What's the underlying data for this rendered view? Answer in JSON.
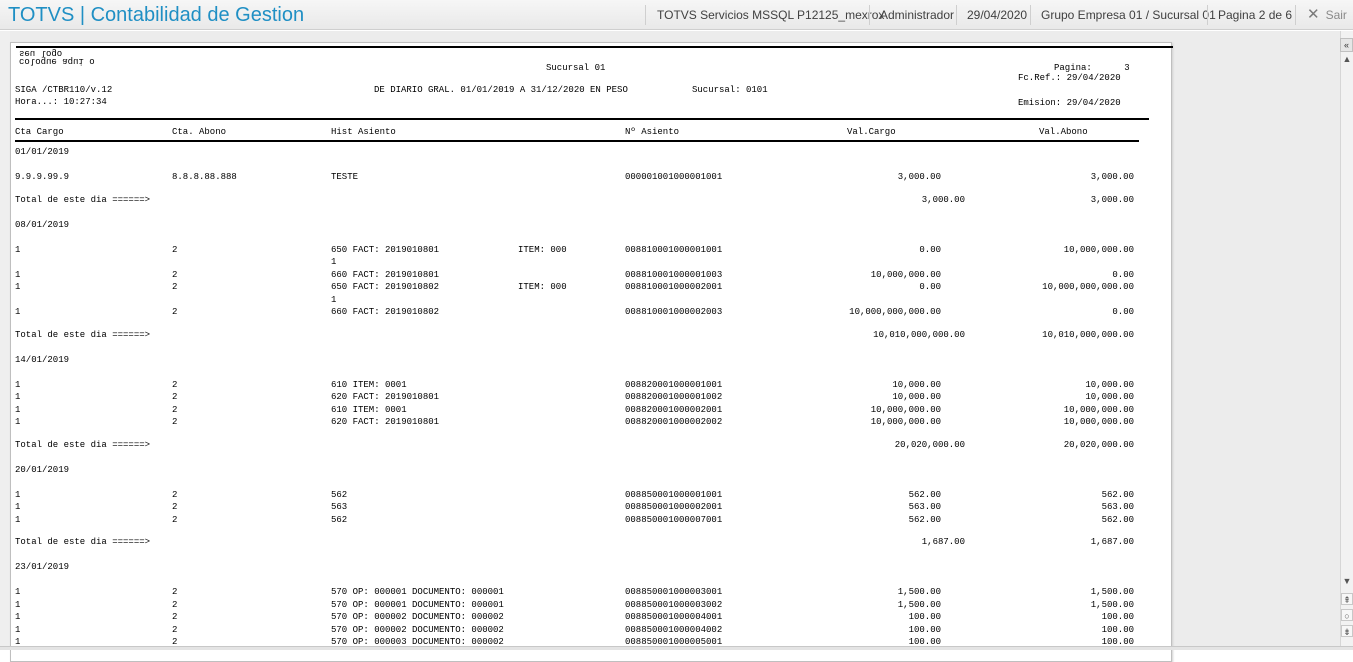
{
  "header": {
    "app_title": "TOTVS | Contabilidad de Gestion",
    "environment": "TOTVS Servicios MSSQL P12125_mexrox",
    "user": "Administrador",
    "date": "29/04/2020",
    "company": "Grupo Empresa 01 / Sucursal 01",
    "page": "Pagina 2 de 6",
    "exit_label": "Sair",
    "exit_icon": "close-icon"
  },
  "report": {
    "logo_text": "coloque aqui o seu logo",
    "title_branch": "Sucursal 01",
    "pagina": "Pagina:      3",
    "fc_ref": "Fc.Ref.: 29/04/2020",
    "program": "SIGA /CTBR110/v.12",
    "period": "DE DIARIO GRAL. 01/01/2019 A 31/12/2020 EN PESO",
    "sucursal": "Sucursal: 0101",
    "hora": "Hora...: 10:27:34",
    "emision": "Emision: 29/04/2020",
    "columns": {
      "cta_cargo": "Cta Cargo",
      "cta_abono": "Cta. Abono",
      "hist": "Hist Asiento",
      "asiento": "Nº Asiento",
      "val_cargo": "Val.Cargo",
      "val_abono": "Val.Abono"
    },
    "total_label": "Total de este dia ======>",
    "days": [
      {
        "date": "01/01/2019",
        "rows": [
          {
            "cargo": "9.9.9.99.9",
            "abono": "8.8.8.88.888",
            "hist": "TESTE",
            "item": "",
            "cont": "",
            "asiento": "000001001000001001",
            "vcargo": "3,000.00",
            "vabono": "3,000.00"
          }
        ],
        "total_cargo": "3,000.00",
        "total_abono": "3,000.00"
      },
      {
        "date": "08/01/2019",
        "rows": [
          {
            "cargo": "1",
            "abono": "2",
            "hist": "650 FACT: 2019010801",
            "item": "ITEM: 000",
            "cont": "1",
            "asiento": "008810001000001001",
            "vcargo": "0.00",
            "vabono": "10,000,000.00"
          },
          {
            "cargo": "1",
            "abono": "2",
            "hist": "660 FACT: 2019010801",
            "item": "",
            "cont": "",
            "asiento": "008810001000001003",
            "vcargo": "10,000,000.00",
            "vabono": "0.00"
          },
          {
            "cargo": "1",
            "abono": "2",
            "hist": "650 FACT: 2019010802",
            "item": "ITEM: 000",
            "cont": "1",
            "asiento": "008810001000002001",
            "vcargo": "0.00",
            "vabono": "10,000,000,000.00"
          },
          {
            "cargo": "1",
            "abono": "2",
            "hist": "660 FACT: 2019010802",
            "item": "",
            "cont": "",
            "asiento": "008810001000002003",
            "vcargo": "10,000,000,000.00",
            "vabono": "0.00"
          }
        ],
        "total_cargo": "10,010,000,000.00",
        "total_abono": "10,010,000,000.00"
      },
      {
        "date": "14/01/2019",
        "rows": [
          {
            "cargo": "1",
            "abono": "2",
            "hist": "610 ITEM: 0001",
            "item": "",
            "cont": "",
            "asiento": "008820001000001001",
            "vcargo": "10,000.00",
            "vabono": "10,000.00"
          },
          {
            "cargo": "1",
            "abono": "2",
            "hist": "620 FACT: 2019010801",
            "item": "",
            "cont": "",
            "asiento": "008820001000001002",
            "vcargo": "10,000.00",
            "vabono": "10,000.00"
          },
          {
            "cargo": "1",
            "abono": "2",
            "hist": "610 ITEM: 0001",
            "item": "",
            "cont": "",
            "asiento": "008820001000002001",
            "vcargo": "10,000,000.00",
            "vabono": "10,000,000.00"
          },
          {
            "cargo": "1",
            "abono": "2",
            "hist": "620 FACT: 2019010801",
            "item": "",
            "cont": "",
            "asiento": "008820001000002002",
            "vcargo": "10,000,000.00",
            "vabono": "10,000,000.00"
          }
        ],
        "total_cargo": "20,020,000.00",
        "total_abono": "20,020,000.00"
      },
      {
        "date": "20/01/2019",
        "rows": [
          {
            "cargo": "1",
            "abono": "2",
            "hist": "562",
            "item": "",
            "cont": "",
            "asiento": "008850001000001001",
            "vcargo": "562.00",
            "vabono": "562.00"
          },
          {
            "cargo": "1",
            "abono": "2",
            "hist": "563",
            "item": "",
            "cont": "",
            "asiento": "008850001000002001",
            "vcargo": "563.00",
            "vabono": "563.00"
          },
          {
            "cargo": "1",
            "abono": "2",
            "hist": "562",
            "item": "",
            "cont": "",
            "asiento": "008850001000007001",
            "vcargo": "562.00",
            "vabono": "562.00"
          }
        ],
        "total_cargo": "1,687.00",
        "total_abono": "1,687.00"
      },
      {
        "date": "23/01/2019",
        "rows": [
          {
            "cargo": "1",
            "abono": "2",
            "hist": "570 OP: 000001 DOCUMENTO: 000001",
            "item": "",
            "cont": "",
            "asiento": "008850001000003001",
            "vcargo": "1,500.00",
            "vabono": "1,500.00"
          },
          {
            "cargo": "1",
            "abono": "2",
            "hist": "570 OP: 000001 DOCUMENTO: 000001",
            "item": "",
            "cont": "",
            "asiento": "008850001000003002",
            "vcargo": "1,500.00",
            "vabono": "1,500.00"
          },
          {
            "cargo": "1",
            "abono": "2",
            "hist": "570 OP: 000002 DOCUMENTO: 000002",
            "item": "",
            "cont": "",
            "asiento": "008850001000004001",
            "vcargo": "100.00",
            "vabono": "100.00"
          },
          {
            "cargo": "1",
            "abono": "2",
            "hist": "570 OP: 000002 DOCUMENTO: 000002",
            "item": "",
            "cont": "",
            "asiento": "008850001000004002",
            "vcargo": "100.00",
            "vabono": "100.00"
          },
          {
            "cargo": "1",
            "abono": "2",
            "hist": "570 OP: 000003 DOCUMENTO: 000002",
            "item": "",
            "cont": "",
            "asiento": "008850001000005001",
            "vcargo": "100.00",
            "vabono": "100.00"
          }
        ]
      }
    ]
  },
  "scrollbar": {
    "up_icon": "arrow-up-icon",
    "down_icon": "arrow-down-icon",
    "top_icon": "page-top-icon",
    "bottom_icon": "page-bottom-icon",
    "collapse_icon": "collapse-panel-icon"
  }
}
